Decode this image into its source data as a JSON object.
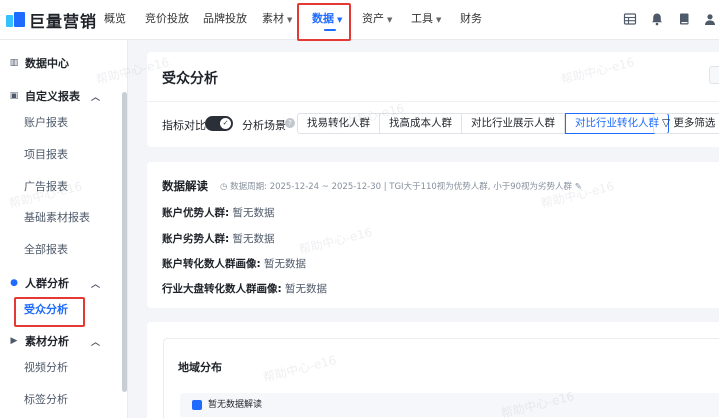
{
  "brand": {
    "name": "巨量营销"
  },
  "topnav": {
    "items": [
      "概览",
      "竞价投放",
      "品牌投放",
      "素材",
      "数据",
      "资产",
      "工具",
      "财务"
    ],
    "active": "数据",
    "icons": [
      "grid-icon",
      "bell-icon",
      "book-icon",
      "user-icon"
    ]
  },
  "sidebar": {
    "groups": [
      {
        "label": "数据中心",
        "icon": "bar-chart-icon"
      },
      {
        "label": "自定义报表",
        "icon": "report-icon",
        "items": [
          "账户报表",
          "项目报表",
          "广告报表",
          "基础素材报表",
          "全部报表"
        ]
      },
      {
        "label": "人群分析",
        "icon": "people-icon",
        "items": [
          "受众分析"
        ]
      },
      {
        "label": "素材分析",
        "icon": "video-icon",
        "items": [
          "视频分析",
          "标签分析"
        ]
      }
    ],
    "active_item": "受众分析"
  },
  "main": {
    "title": "受众分析",
    "compare_label": "指标对比",
    "scene_label": "分析场景",
    "scene_tabs": [
      "找易转化人群",
      "找高成本人群",
      "对比行业展示人群",
      "对比行业转化人群"
    ],
    "scene_selected": "对比行业转化人群",
    "more_filter": "更多筛选",
    "interpretation": {
      "title": "数据解读",
      "meta": "数据周期: 2025-12-24 ~ 2025-12-30  |  TGI大于110视为优势人群, 小于90视为劣势人群",
      "rows": [
        {
          "k": "账户优势人群:",
          "v": "暂无数据"
        },
        {
          "k": "账户劣势人群:",
          "v": "暂无数据"
        },
        {
          "k": "账户转化数人群画像:",
          "v": "暂无数据"
        },
        {
          "k": "行业大盘转化数人群画像:",
          "v": "暂无数据"
        }
      ]
    },
    "region": {
      "title": "地域分布",
      "notice": "暂无数据解读"
    }
  },
  "watermark": "帮助中心-e16",
  "colors": {
    "accent": "#1f6bff",
    "highlight_box": "#e53935"
  }
}
